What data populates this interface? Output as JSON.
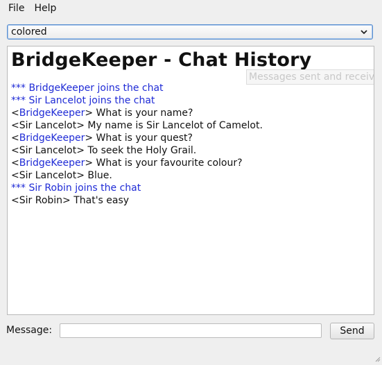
{
  "menu": {
    "file": "File",
    "help": "Help"
  },
  "style_select": {
    "value": "colored"
  },
  "chat": {
    "title": "BridgeKeeper - Chat History",
    "tooltip": "Messages sent and received",
    "messages": [
      {
        "type": "join",
        "text": "*** BridgeKeeper joins the chat"
      },
      {
        "type": "join",
        "text": "*** Sir Lancelot joins the chat"
      },
      {
        "type": "msg",
        "nick": "BridgeKeeper",
        "colored": true,
        "text": " What is your name?"
      },
      {
        "type": "msg",
        "nick": "Sir Lancelot",
        "colored": false,
        "text": " My name is Sir Lancelot of Camelot."
      },
      {
        "type": "msg",
        "nick": "BridgeKeeper",
        "colored": true,
        "text": " What is your quest?"
      },
      {
        "type": "msg",
        "nick": "Sir Lancelot",
        "colored": false,
        "text": " To seek the Holy Grail."
      },
      {
        "type": "msg",
        "nick": "BridgeKeeper",
        "colored": true,
        "text": " What is your favourite colour?"
      },
      {
        "type": "msg",
        "nick": "Sir Lancelot",
        "colored": false,
        "text": " Blue."
      },
      {
        "type": "join",
        "text": "*** Sir Robin joins the chat"
      },
      {
        "type": "msg",
        "nick": "Sir Robin",
        "colored": false,
        "text": " That's easy"
      }
    ]
  },
  "message_field": {
    "label": "Message:",
    "value": ""
  },
  "send_label": "Send",
  "colors": {
    "nick": "#1f2bd6",
    "focus": "#5a8fcf"
  }
}
